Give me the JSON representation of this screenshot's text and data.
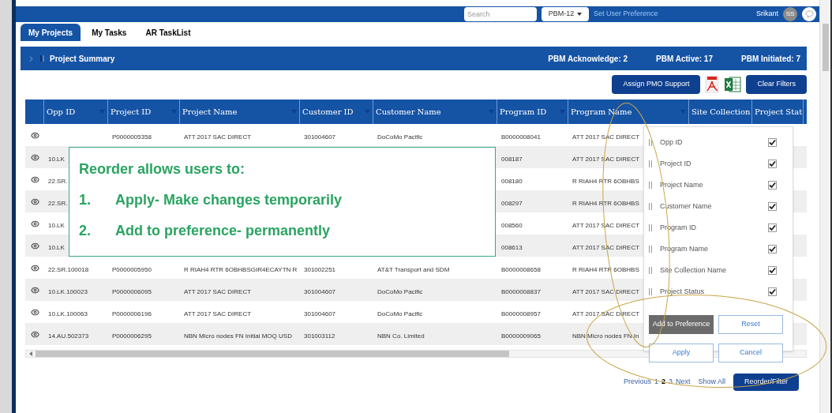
{
  "top_bar": {
    "search": {
      "placeholder": "Search"
    },
    "project_select": "PBM-12",
    "preference_link": "Set User Preference",
    "user_name": "Srikant",
    "avatar_initials": "SS"
  },
  "tabs": [
    {
      "label": "My Projects",
      "selected": true
    },
    {
      "label": "My Tasks",
      "selected": false
    },
    {
      "label": "AR TaskList",
      "selected": false
    }
  ],
  "summary_bar": {
    "title": "Project Summary",
    "expanded": false,
    "stats": [
      "PBM Acknowledge: 2",
      "PBM Active: 17",
      "PBM Initiated: 7"
    ]
  },
  "toolbar": {
    "buttons": [
      "Assign PMO Support",
      "Clear Filters"
    ]
  },
  "table": {
    "columns": [
      "Opp ID",
      "Project ID",
      "Project Name",
      "Customer ID",
      "Customer Name",
      "Program ID",
      "Program Name",
      "Site Collection",
      "Project Stat"
    ],
    "rows": [
      {
        "cells": [
          null,
          "P0000005358",
          "ATT 2017 SAC DIRECT",
          "301004607",
          "DoCoMo Pacific",
          "B0000008041",
          "ATT 2017 SAC DIRECT"
        ]
      },
      {
        "cells": [
          "10.LK",
          null,
          null,
          null,
          null,
          "008187",
          "ATT 2017 SAC DIRECT"
        ]
      },
      {
        "cells": [
          "22.SR.",
          null,
          null,
          null,
          null,
          "008180",
          "R RIAH4 RTR 6OBHBS"
        ]
      },
      {
        "cells": [
          "22.SR.",
          null,
          null,
          null,
          null,
          "008297",
          "R RIAH4 RTR 6OBHBS"
        ]
      },
      {
        "cells": [
          "10.LK",
          null,
          null,
          null,
          null,
          "008560",
          "ATT 2017 SAC DIRECT"
        ]
      },
      {
        "cells": [
          "10.LK",
          null,
          null,
          null,
          null,
          "008613",
          "ATT 2017 SAC DIRECT"
        ]
      },
      {
        "cells": [
          "22.SR.100018",
          "P0000005950",
          "R RIAH4 RTR 6OBHBSGIR4ECAYTN R",
          "301002251",
          "AT&T Transport and SDM",
          "B0000008658",
          "R RIAH4 RTR 6OBHBS"
        ]
      },
      {
        "cells": [
          "10.LK.100023",
          "P0000006095",
          "ATT 2017 SAC DIRECT",
          "301004607",
          "DoCoMo Pacific",
          "B0000008837",
          "ATT 2017 SAC DIRECT"
        ]
      },
      {
        "cells": [
          "10.LK.100063",
          "P0000006196",
          "ATT 2017 SAC DIRECT",
          "301004607",
          "DoCoMo Pacific",
          "B0000008957",
          "ATT 2017 SAC DIRECT"
        ]
      },
      {
        "cells": [
          "14.AU.502373",
          "P0000006295",
          "NBN Micro nodes FN Initial MOQ USD",
          "301003112",
          "NBN Co. Limited",
          "B0000009065",
          "NBN Micro nodes FN In"
        ]
      }
    ]
  },
  "column_menu": {
    "items": [
      {
        "label": "Opp ID",
        "checked": true
      },
      {
        "label": "Project ID",
        "checked": true
      },
      {
        "label": "Project Name",
        "checked": true
      },
      {
        "label": "Customer Name",
        "checked": true
      },
      {
        "label": "Program ID",
        "checked": true
      },
      {
        "label": "Program Name",
        "checked": true
      },
      {
        "label": "Site Collection Name",
        "checked": true
      },
      {
        "label": "Project Status",
        "checked": true
      }
    ],
    "buttons": [
      {
        "label": "Add to Preference",
        "kind": "primary"
      },
      {
        "label": "Reset",
        "kind": "outline"
      },
      {
        "label": "Apply",
        "kind": "outline"
      },
      {
        "label": "Cancel",
        "kind": "outline"
      }
    ]
  },
  "pagination": {
    "previous": "Previous",
    "pages": [
      {
        "label": "1",
        "selected": false
      },
      {
        "label": "2",
        "selected": true
      },
      {
        "label": "3",
        "selected": false
      }
    ],
    "next": "Next",
    "show_all": "Show All",
    "reorder_button": "Reorder/Filter"
  },
  "callout": {
    "title": "Reorder allows users to:",
    "points": [
      {
        "number": "1.",
        "text": "Apply- Make changes temporarily"
      },
      {
        "number": "2.",
        "text": "Add to preference- permanently"
      }
    ]
  }
}
